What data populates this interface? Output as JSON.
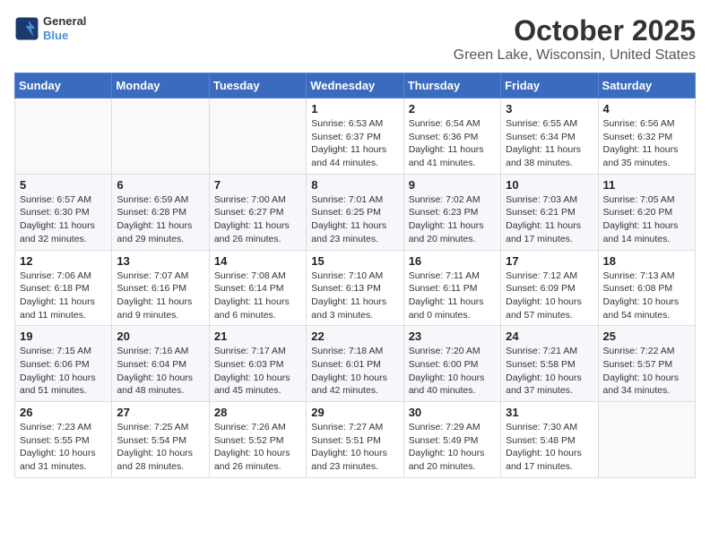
{
  "header": {
    "logo": {
      "line1": "General",
      "line2": "Blue"
    },
    "title": "October 2025",
    "subtitle": "Green Lake, Wisconsin, United States"
  },
  "calendar": {
    "weekdays": [
      "Sunday",
      "Monday",
      "Tuesday",
      "Wednesday",
      "Thursday",
      "Friday",
      "Saturday"
    ],
    "weeks": [
      [
        {
          "day": "",
          "info": ""
        },
        {
          "day": "",
          "info": ""
        },
        {
          "day": "",
          "info": ""
        },
        {
          "day": "1",
          "info": "Sunrise: 6:53 AM\nSunset: 6:37 PM\nDaylight: 11 hours\nand 44 minutes."
        },
        {
          "day": "2",
          "info": "Sunrise: 6:54 AM\nSunset: 6:36 PM\nDaylight: 11 hours\nand 41 minutes."
        },
        {
          "day": "3",
          "info": "Sunrise: 6:55 AM\nSunset: 6:34 PM\nDaylight: 11 hours\nand 38 minutes."
        },
        {
          "day": "4",
          "info": "Sunrise: 6:56 AM\nSunset: 6:32 PM\nDaylight: 11 hours\nand 35 minutes."
        }
      ],
      [
        {
          "day": "5",
          "info": "Sunrise: 6:57 AM\nSunset: 6:30 PM\nDaylight: 11 hours\nand 32 minutes."
        },
        {
          "day": "6",
          "info": "Sunrise: 6:59 AM\nSunset: 6:28 PM\nDaylight: 11 hours\nand 29 minutes."
        },
        {
          "day": "7",
          "info": "Sunrise: 7:00 AM\nSunset: 6:27 PM\nDaylight: 11 hours\nand 26 minutes."
        },
        {
          "day": "8",
          "info": "Sunrise: 7:01 AM\nSunset: 6:25 PM\nDaylight: 11 hours\nand 23 minutes."
        },
        {
          "day": "9",
          "info": "Sunrise: 7:02 AM\nSunset: 6:23 PM\nDaylight: 11 hours\nand 20 minutes."
        },
        {
          "day": "10",
          "info": "Sunrise: 7:03 AM\nSunset: 6:21 PM\nDaylight: 11 hours\nand 17 minutes."
        },
        {
          "day": "11",
          "info": "Sunrise: 7:05 AM\nSunset: 6:20 PM\nDaylight: 11 hours\nand 14 minutes."
        }
      ],
      [
        {
          "day": "12",
          "info": "Sunrise: 7:06 AM\nSunset: 6:18 PM\nDaylight: 11 hours\nand 11 minutes."
        },
        {
          "day": "13",
          "info": "Sunrise: 7:07 AM\nSunset: 6:16 PM\nDaylight: 11 hours\nand 9 minutes."
        },
        {
          "day": "14",
          "info": "Sunrise: 7:08 AM\nSunset: 6:14 PM\nDaylight: 11 hours\nand 6 minutes."
        },
        {
          "day": "15",
          "info": "Sunrise: 7:10 AM\nSunset: 6:13 PM\nDaylight: 11 hours\nand 3 minutes."
        },
        {
          "day": "16",
          "info": "Sunrise: 7:11 AM\nSunset: 6:11 PM\nDaylight: 11 hours\nand 0 minutes."
        },
        {
          "day": "17",
          "info": "Sunrise: 7:12 AM\nSunset: 6:09 PM\nDaylight: 10 hours\nand 57 minutes."
        },
        {
          "day": "18",
          "info": "Sunrise: 7:13 AM\nSunset: 6:08 PM\nDaylight: 10 hours\nand 54 minutes."
        }
      ],
      [
        {
          "day": "19",
          "info": "Sunrise: 7:15 AM\nSunset: 6:06 PM\nDaylight: 10 hours\nand 51 minutes."
        },
        {
          "day": "20",
          "info": "Sunrise: 7:16 AM\nSunset: 6:04 PM\nDaylight: 10 hours\nand 48 minutes."
        },
        {
          "day": "21",
          "info": "Sunrise: 7:17 AM\nSunset: 6:03 PM\nDaylight: 10 hours\nand 45 minutes."
        },
        {
          "day": "22",
          "info": "Sunrise: 7:18 AM\nSunset: 6:01 PM\nDaylight: 10 hours\nand 42 minutes."
        },
        {
          "day": "23",
          "info": "Sunrise: 7:20 AM\nSunset: 6:00 PM\nDaylight: 10 hours\nand 40 minutes."
        },
        {
          "day": "24",
          "info": "Sunrise: 7:21 AM\nSunset: 5:58 PM\nDaylight: 10 hours\nand 37 minutes."
        },
        {
          "day": "25",
          "info": "Sunrise: 7:22 AM\nSunset: 5:57 PM\nDaylight: 10 hours\nand 34 minutes."
        }
      ],
      [
        {
          "day": "26",
          "info": "Sunrise: 7:23 AM\nSunset: 5:55 PM\nDaylight: 10 hours\nand 31 minutes."
        },
        {
          "day": "27",
          "info": "Sunrise: 7:25 AM\nSunset: 5:54 PM\nDaylight: 10 hours\nand 28 minutes."
        },
        {
          "day": "28",
          "info": "Sunrise: 7:26 AM\nSunset: 5:52 PM\nDaylight: 10 hours\nand 26 minutes."
        },
        {
          "day": "29",
          "info": "Sunrise: 7:27 AM\nSunset: 5:51 PM\nDaylight: 10 hours\nand 23 minutes."
        },
        {
          "day": "30",
          "info": "Sunrise: 7:29 AM\nSunset: 5:49 PM\nDaylight: 10 hours\nand 20 minutes."
        },
        {
          "day": "31",
          "info": "Sunrise: 7:30 AM\nSunset: 5:48 PM\nDaylight: 10 hours\nand 17 minutes."
        },
        {
          "day": "",
          "info": ""
        }
      ]
    ]
  }
}
